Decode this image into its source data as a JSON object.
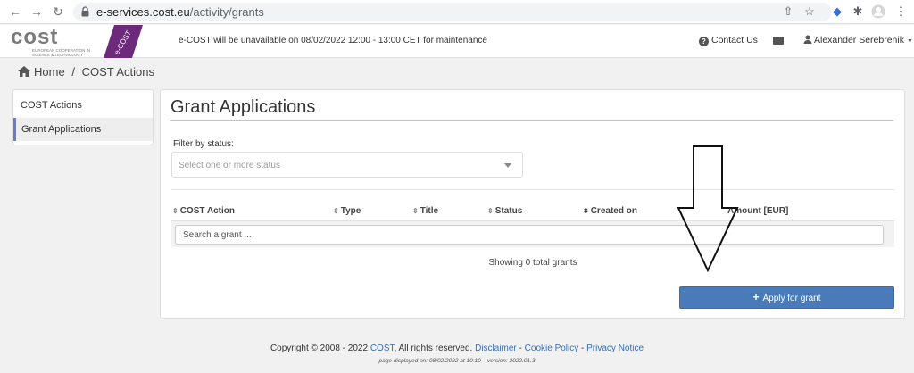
{
  "browser": {
    "url_host": "e-services.cost.eu",
    "url_path": "/activity/grants"
  },
  "header": {
    "logo_word": "cost",
    "logo_sub": "EUROPEAN COOPERATION IN SCIENCE & TECHNOLOGY",
    "badge": "e-COST",
    "notice": "e-COST will be unavailable on 08/02/2022 12:00 - 13:00 CET for maintenance",
    "contact_label": "Contact Us",
    "user_name": "Alexander Serebrenik"
  },
  "breadcrumb": {
    "home": "Home",
    "separator": "/",
    "current": "COST Actions"
  },
  "sidebar": {
    "items": [
      {
        "label": "COST Actions"
      },
      {
        "label": "Grant Applications"
      }
    ]
  },
  "main": {
    "title": "Grant Applications",
    "filter_label": "Filter by status:",
    "filter_placeholder": "Select one or more status",
    "columns": [
      "COST Action",
      "Type",
      "Title",
      "Status",
      "Created on",
      "Amount [EUR]"
    ],
    "search_placeholder": "Search a grant ...",
    "total_text": "Showing 0 total grants",
    "apply_label": "Apply for grant"
  },
  "footer": {
    "copyright_prefix": "Copyright © 2008 - 2022",
    "cost_link": "COST",
    "rights": ", All rights reserved.",
    "disclaimer": "Disclaimer",
    "dash": " - ",
    "cookie": "Cookie Policy",
    "privacy": "Privacy Notice",
    "displayed": "page displayed on: 08/02/2022 at 10:10 – version: 2022.01.3"
  },
  "colors": {
    "accent": "#4a7ab8",
    "badge": "#6d2a7a",
    "active_indicator": "#6b7ec4"
  }
}
